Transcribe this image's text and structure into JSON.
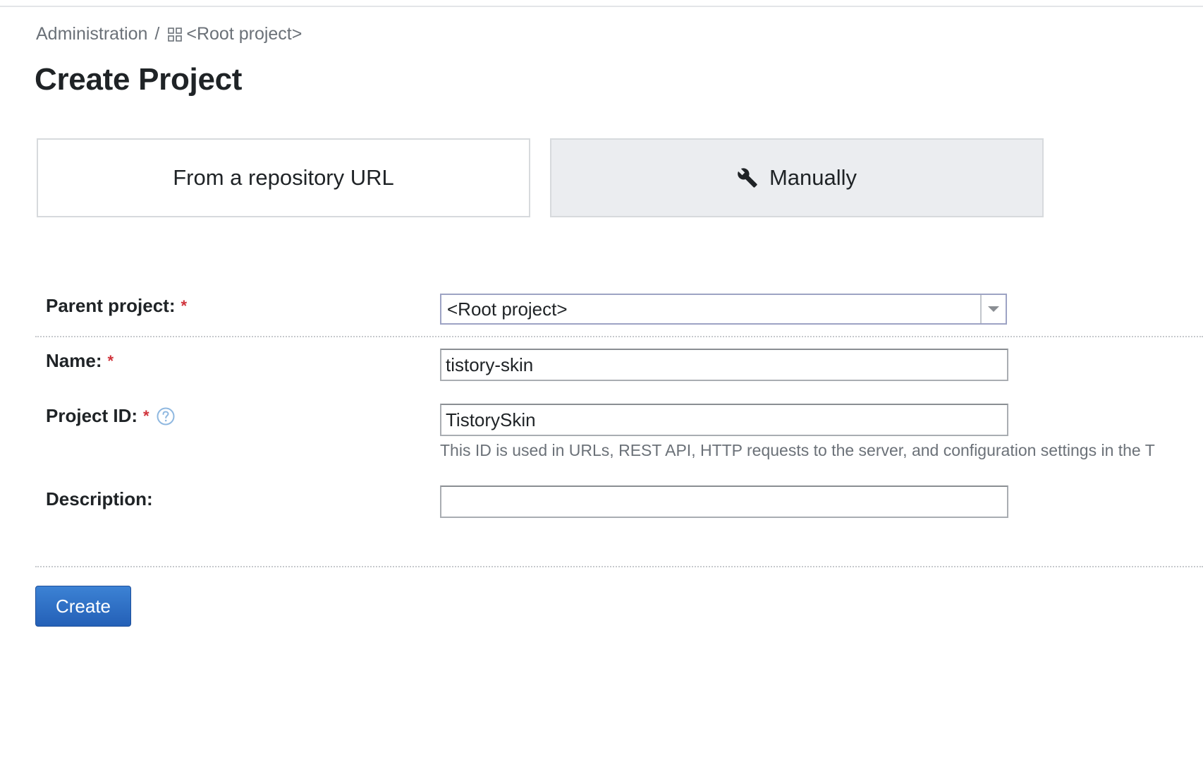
{
  "breadcrumb": {
    "root": "Administration",
    "separator": "/",
    "project": "<Root project>",
    "project_icon": "project-grid-icon"
  },
  "page_title": "Create Project",
  "modes": {
    "from_url_label": "From a repository URL",
    "manual_label": "Manually",
    "manual_icon": "wrench-icon",
    "selected": "Manually"
  },
  "form": {
    "parent_project": {
      "label": "Parent project:",
      "required_mark": "*",
      "value": "<Root project>"
    },
    "name": {
      "label": "Name:",
      "required_mark": "*",
      "value": "tistory-skin"
    },
    "project_id": {
      "label": "Project ID:",
      "required_mark": "*",
      "value": "TistorySkin",
      "hint": "This ID is used in URLs, REST API, HTTP requests to the server, and configuration settings in the T"
    },
    "description": {
      "label": "Description:",
      "value": ""
    }
  },
  "actions": {
    "create_label": "Create"
  },
  "colors": {
    "required": "#d0323a",
    "primary_button": "#2d6bc4",
    "selected_tab_bg": "#ebedf0",
    "help_icon": "#8fb8e0"
  }
}
